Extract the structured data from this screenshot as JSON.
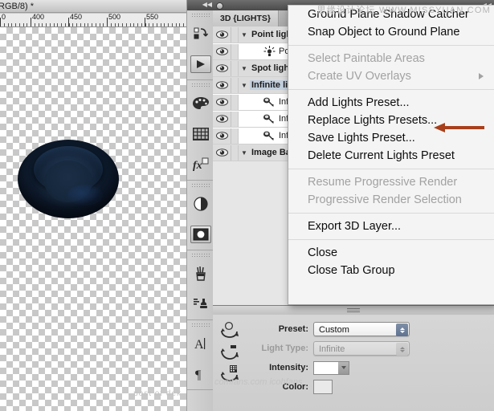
{
  "document": {
    "title": "RGB/8) *",
    "ruler": {
      "unit": "px",
      "labels": [
        "0",
        "400",
        "450",
        "500",
        "550"
      ],
      "label_positions": [
        0,
        38,
        85,
        133,
        180
      ],
      "major_spacing": 47.5
    },
    "canvas_watermark": "post of dek",
    "object_name": "3d-bowl-object"
  },
  "toolstrip": {
    "groups": [
      {
        "tools": [
          {
            "name": "3d-object-rotate-tool",
            "glyph": "rotate-3d-icon"
          },
          {
            "name": "3d-camera-tool",
            "glyph": "play-triangle-icon"
          }
        ]
      },
      {
        "tools": [
          {
            "name": "palette-tool",
            "glyph": "palette-icon"
          },
          {
            "name": "grid-pattern-tool",
            "glyph": "grid-icon"
          },
          {
            "name": "fx-styles-tool",
            "glyph": "fx-icon"
          }
        ]
      },
      {
        "tools": [
          {
            "name": "adjustment-tool",
            "glyph": "half-circle-icon"
          },
          {
            "name": "mask-tool",
            "glyph": "mask-circle-icon"
          }
        ]
      },
      {
        "tools": [
          {
            "name": "brush-presets-tool",
            "glyph": "brushes-jar-icon"
          },
          {
            "name": "clone-source-tool",
            "glyph": "stamp-icon"
          }
        ]
      },
      {
        "tools": [
          {
            "name": "character-panel-tool",
            "glyph": "text-A-icon"
          },
          {
            "name": "paragraph-panel-tool",
            "glyph": "pilcrow-icon"
          }
        ]
      }
    ]
  },
  "panel": {
    "watermark": "思缘设计论坛  WWW.MISSYUAN.COM",
    "tabs": [
      {
        "label": "3D {LIGHTS}",
        "active": true
      },
      {
        "label": "",
        "active": false
      }
    ],
    "scene_items": [
      {
        "label": "Point lights",
        "type": "group",
        "twisty": "▼",
        "icon": "",
        "depth": 0,
        "selected": false
      },
      {
        "label": "Point Li",
        "type": "light",
        "twisty": "",
        "icon": "point-light-icon",
        "depth": 1,
        "selected": false
      },
      {
        "label": "Spot lights",
        "type": "group",
        "twisty": "▼",
        "icon": "",
        "depth": 0,
        "selected": false
      },
      {
        "label": "Infinite ligh",
        "type": "group",
        "twisty": "▼",
        "icon": "",
        "depth": 0,
        "selected": true
      },
      {
        "label": "Infinite",
        "type": "light",
        "twisty": "",
        "icon": "infinite-light-icon",
        "depth": 1,
        "selected": false
      },
      {
        "label": "Infinite",
        "type": "light",
        "twisty": "",
        "icon": "infinite-light-icon",
        "depth": 1,
        "selected": false
      },
      {
        "label": "Infinite",
        "type": "light",
        "twisty": "",
        "icon": "infinite-light-icon",
        "depth": 1,
        "selected": false
      },
      {
        "label": "Image Based",
        "type": "group",
        "twisty": "▼",
        "icon": "",
        "depth": 0,
        "selected": false
      }
    ],
    "properties": {
      "watermark": "comfans.com  icohfans",
      "tools": [
        {
          "name": "rotate-light-tool",
          "glyph": "rotate-light-icon"
        },
        {
          "name": "pan-light-tool",
          "glyph": "pan-light-icon"
        },
        {
          "name": "slide-light-tool",
          "glyph": "slide-light-icon"
        }
      ],
      "rows": [
        {
          "label": "Preset:",
          "value": "Custom",
          "control": "combo",
          "disabled": false
        },
        {
          "label": "Light Type:",
          "value": "Infinite",
          "control": "combo",
          "disabled": true
        },
        {
          "label": "Intensity:",
          "value": "",
          "control": "number",
          "disabled": false
        },
        {
          "label": "Color:",
          "value": "",
          "control": "swatch",
          "disabled": false
        }
      ]
    }
  },
  "context_menu": {
    "items": [
      {
        "label": "Ground Plane Shadow Catcher",
        "disabled": false,
        "submenu": false
      },
      {
        "label": "Snap Object to Ground Plane",
        "disabled": false,
        "submenu": false
      },
      {
        "separator": true
      },
      {
        "label": "Select Paintable Areas",
        "disabled": true,
        "submenu": false
      },
      {
        "label": "Create UV Overlays",
        "disabled": true,
        "submenu": true
      },
      {
        "separator": true
      },
      {
        "label": "Add Lights Preset...",
        "disabled": false,
        "submenu": false
      },
      {
        "label": "Replace Lights Presets...",
        "disabled": false,
        "submenu": false,
        "highlighted_by_arrow": true
      },
      {
        "label": "Save Lights Preset...",
        "disabled": false,
        "submenu": false
      },
      {
        "label": "Delete Current Lights Preset",
        "disabled": false,
        "submenu": false
      },
      {
        "separator": true
      },
      {
        "label": "Resume Progressive Render",
        "disabled": true,
        "submenu": false
      },
      {
        "label": "Progressive Render Selection",
        "disabled": true,
        "submenu": false
      },
      {
        "separator": true
      },
      {
        "label": "Export 3D Layer...",
        "disabled": false,
        "submenu": false
      },
      {
        "separator": true
      },
      {
        "label": "Close",
        "disabled": false,
        "submenu": false
      },
      {
        "label": "Close Tab Group",
        "disabled": false,
        "submenu": false
      }
    ]
  },
  "annotation": {
    "arrow_color": "#A8401B",
    "arrow_target": "Replace Lights Presets..."
  },
  "colors": {
    "menu_bg": "#f4f4f4",
    "menu_text": "#0d0d0d",
    "menu_text_disabled": "#a2a2a2",
    "panel_bg": "#d3d3d3",
    "list_bg": "#e6e6e6",
    "selection_blue": "#c2cfdd",
    "object_navy": "#0e1b2c",
    "accent_arrow": "#A8401B"
  }
}
